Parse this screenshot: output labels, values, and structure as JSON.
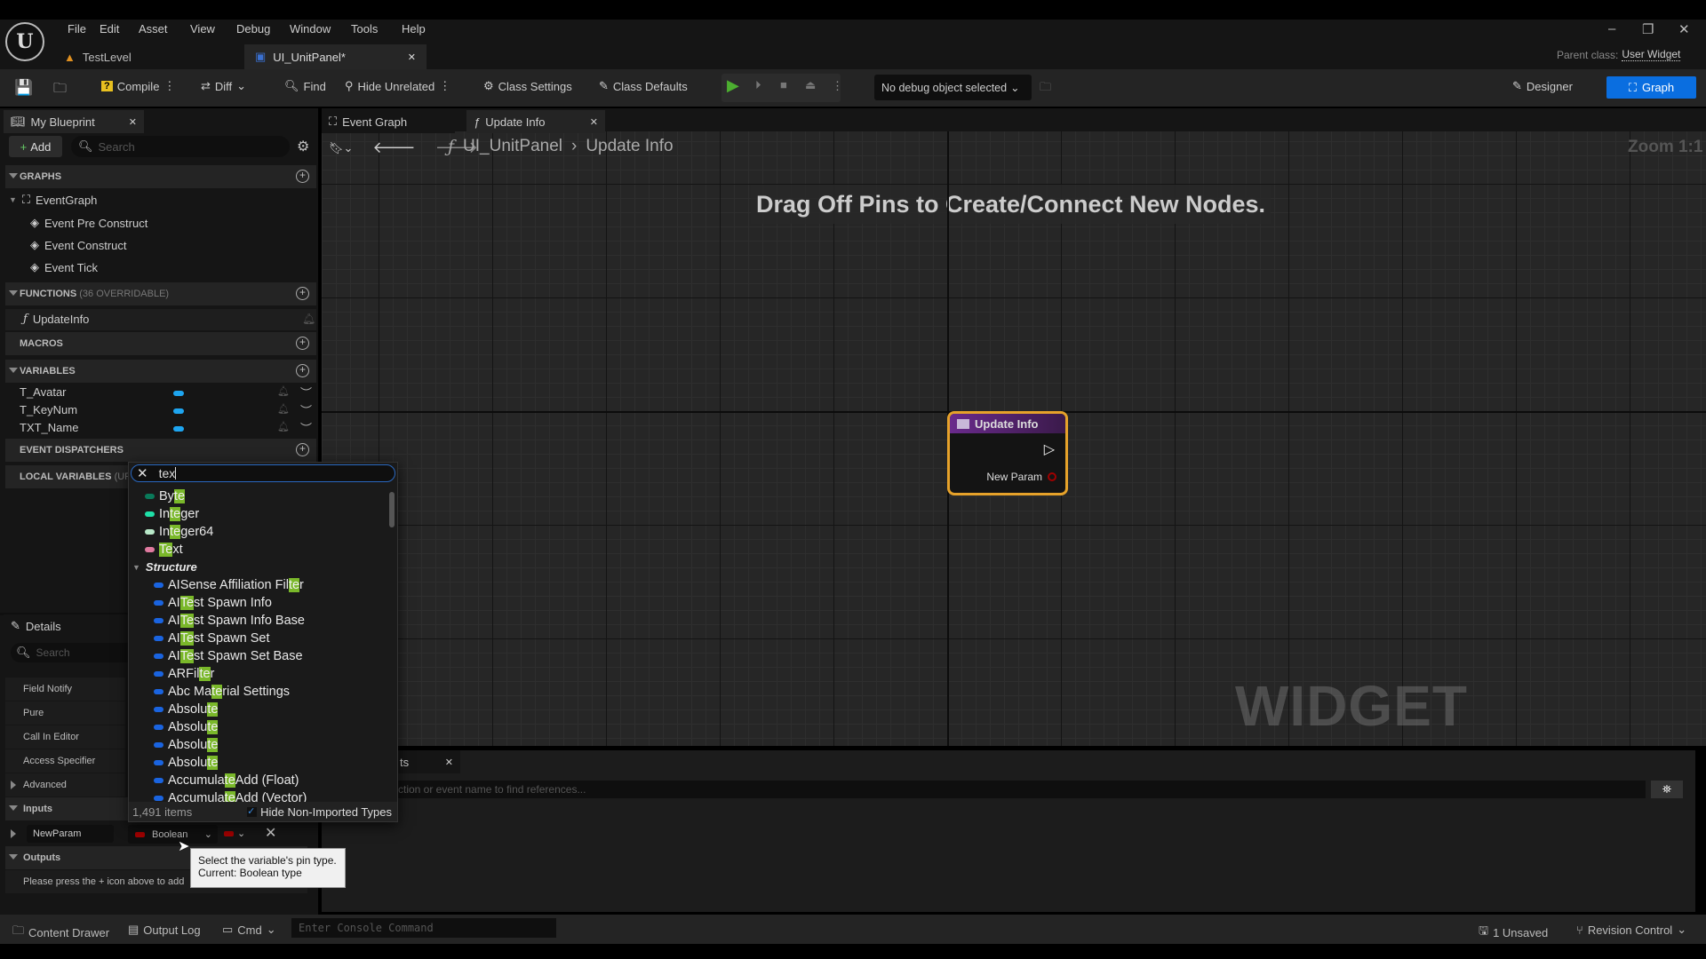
{
  "menu": {
    "items": [
      "File",
      "Edit",
      "Asset",
      "View",
      "Debug",
      "Window",
      "Tools",
      "Help"
    ]
  },
  "doc_tabs": [
    {
      "label": "TestLevel",
      "icon": "level-icon"
    },
    {
      "label": "UI_UnitPanel*",
      "icon": "widget-blueprint-icon",
      "active": true
    }
  ],
  "parent_class": {
    "label": "Parent class:",
    "value": "User Widget"
  },
  "toolbar": {
    "compile": "Compile",
    "diff": "Diff",
    "find": "Find",
    "hide_unrelated": "Hide Unrelated",
    "class_settings": "Class Settings",
    "class_defaults": "Class Defaults",
    "debug_object": "No debug object selected",
    "designer": "Designer",
    "graph": "Graph"
  },
  "my_blueprint": {
    "tab": "My Blueprint",
    "add": "Add",
    "search_placeholder": "Search",
    "graphs_header": "GRAPHS",
    "event_graph": "EventGraph",
    "events": [
      "Event Pre Construct",
      "Event Construct",
      "Event Tick"
    ],
    "functions_header": "FUNCTIONS",
    "functions_sub": "(36 OVERRIDABLE)",
    "functions": [
      "UpdateInfo"
    ],
    "macros_header": "MACROS",
    "variables_header": "VARIABLES",
    "variables": [
      "T_Avatar",
      "T_KeyNum",
      "TXT_Name"
    ],
    "dispatchers_header": "EVENT DISPATCHERS",
    "local_header": "LOCAL VARIABLES",
    "local_sub": "(UPD"
  },
  "details": {
    "tab": "Details",
    "search_placeholder": "Search",
    "rows": [
      "Field Notify",
      "Pure",
      "Call In Editor",
      "Access Specifier"
    ],
    "advanced": "Advanced",
    "inputs": "Inputs",
    "param_name": "NewParam",
    "param_type": "Boolean",
    "outputs": "Outputs",
    "outputs_hint": "Please press the + icon above to add"
  },
  "graph_tabs": [
    {
      "label": "Event Graph"
    },
    {
      "label": "Update Info"
    }
  ],
  "breadcrumb": {
    "root": "UI_UnitPanel",
    "current": "Update Info"
  },
  "zoom": "Zoom 1:1",
  "hint": "Drag Off Pins to Create/Connect New Nodes.",
  "watermark": "WIDGET BLUEPRINT",
  "node": {
    "title": "Update Info",
    "pin": "New Param"
  },
  "find_panel": {
    "tab": "ts",
    "placeholder": "ction or event name to find references..."
  },
  "type_picker": {
    "query": "tex",
    "count": "1,491 items",
    "hide_label": "Hide Non-Imported Types",
    "hide_checked": true,
    "category": "Structure",
    "basic": [
      {
        "pre": "By",
        "m": "te",
        "post": "",
        "color": "#0a7a5a"
      },
      {
        "pre": "In",
        "m": "te",
        "post": "ger",
        "color": "#1fe0a8"
      },
      {
        "pre": "In",
        "m": "te",
        "post": "ger64",
        "color": "#b8e8c8"
      },
      {
        "pre": "",
        "m": "Te",
        "post": "xt",
        "color": "#e07aa0"
      }
    ],
    "structs": [
      {
        "pre": "AISense Affiliation Fil",
        "m": "te",
        "post": "r"
      },
      {
        "pre": "AI",
        "m": "Te",
        "post": "st Spawn Info"
      },
      {
        "pre": "AI",
        "m": "Te",
        "post": "st Spawn Info Base"
      },
      {
        "pre": "AI",
        "m": "Te",
        "post": "st Spawn Set"
      },
      {
        "pre": "AI",
        "m": "Te",
        "post": "st Spawn Set Base"
      },
      {
        "pre": "ARFil",
        "m": "te",
        "post": "r"
      },
      {
        "pre": "Abc Ma",
        "m": "te",
        "post": "rial Settings"
      },
      {
        "pre": "Absolu",
        "m": "te",
        "post": ""
      },
      {
        "pre": "Absolu",
        "m": "te",
        "post": ""
      },
      {
        "pre": "Absolu",
        "m": "te",
        "post": ""
      },
      {
        "pre": "Absolu",
        "m": "te",
        "post": ""
      },
      {
        "pre": "Accumula",
        "m": "te",
        "post": " Add (Float)"
      },
      {
        "pre": "Accumula",
        "m": "te",
        "post": " Add (Vector)"
      }
    ],
    "struct_color": "#1a64e0"
  },
  "tooltip": {
    "line1": "Select the variable's pin type.",
    "line2": "Current: Boolean type"
  },
  "statusbar": {
    "content_drawer": "Content Drawer",
    "output_log": "Output Log",
    "cmd": "Cmd",
    "console_placeholder": "Enter Console Command",
    "unsaved": "1 Unsaved",
    "revision": "Revision Control"
  },
  "colors": {
    "accent": "#0070e0",
    "node_border": "#e6a22a",
    "boolean_pin": "#a00000",
    "variable_pin": "#1ea5f0",
    "match_highlight": "#7ab82a"
  }
}
